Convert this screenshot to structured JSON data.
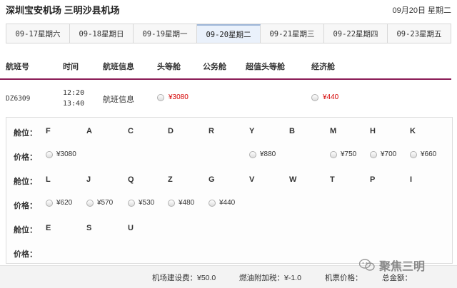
{
  "header": {
    "route": "深圳宝安机场  三明沙县机场",
    "date": "09月20日  星期二"
  },
  "date_tabs": [
    {
      "label": "09-17星期六",
      "active": false
    },
    {
      "label": "09-18星期日",
      "active": false
    },
    {
      "label": "09-19星期一",
      "active": false
    },
    {
      "label": "09-20星期二",
      "active": true
    },
    {
      "label": "09-21星期三",
      "active": false
    },
    {
      "label": "09-22星期四",
      "active": false
    },
    {
      "label": "09-23星期五",
      "active": false
    }
  ],
  "columns": {
    "flight_no": "航班号",
    "time": "时间",
    "info": "航班信息",
    "first": "头等舱",
    "business": "公务舱",
    "premium_first": "超值头等舱",
    "economy": "经济舱"
  },
  "flight": {
    "number": "DZ6309",
    "depart": "12:20",
    "arrive": "13:40",
    "info_link": "航班信息",
    "first_price": "¥3080",
    "economy_price": "¥440"
  },
  "cabin_grid": {
    "cabin_label": "舱位：",
    "price_label": "价格：",
    "row1": {
      "cabins": [
        "F",
        "A",
        "C",
        "D",
        "R",
        "Y",
        "B",
        "M",
        "H",
        "K"
      ],
      "prices": {
        "F": "¥3080",
        "Y": "¥880",
        "M": "¥750",
        "H": "¥700",
        "K": "¥660"
      }
    },
    "row2": {
      "cabins": [
        "L",
        "J",
        "Q",
        "Z",
        "G",
        "V",
        "W",
        "T",
        "P",
        "I"
      ],
      "prices": {
        "L": "¥620",
        "J": "¥570",
        "Q": "¥530",
        "Z": "¥480",
        "G": "¥440"
      }
    },
    "row3": {
      "cabins": [
        "E",
        "S",
        "U"
      ]
    }
  },
  "fees": {
    "airport_fee": "机场建设费：¥50.0",
    "fuel_fee": "燃油附加税：¥-1.0",
    "ticket_price": "机票价格：",
    "total": "总金额："
  },
  "watermark": "聚焦三明",
  "colors": {
    "accent_line": "#8b1c56",
    "price_red": "#d40000",
    "active_tab": "#eaf1fb"
  }
}
